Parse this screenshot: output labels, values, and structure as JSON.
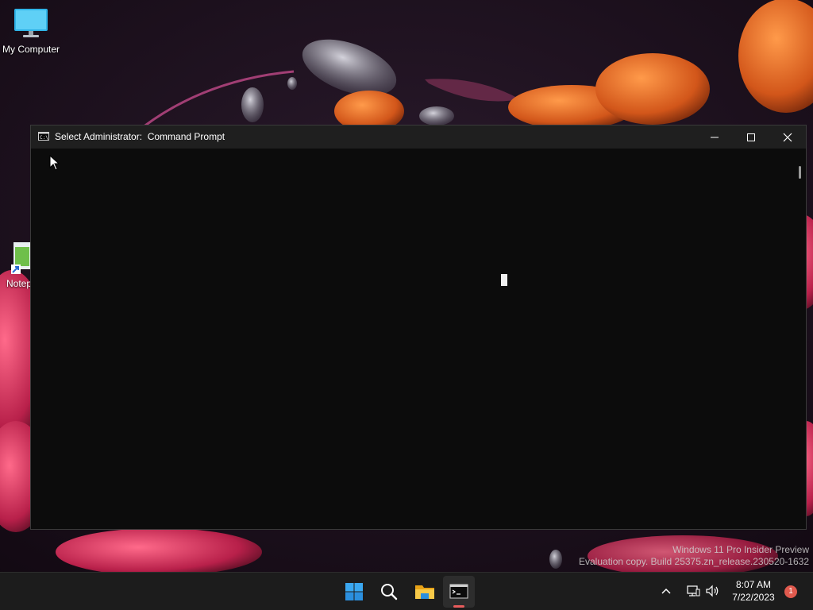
{
  "desktop": {
    "icons": [
      {
        "label": "My Computer",
        "icon": "monitor-icon"
      },
      {
        "label": "Notep",
        "icon": "notepad-shortcut-icon"
      }
    ]
  },
  "window": {
    "title": "Select Administrator:  Command Prompt",
    "icon": "console-icon",
    "controls": {
      "minimize": "minimize-icon",
      "maximize": "maximize-icon",
      "close": "close-icon"
    }
  },
  "watermark": {
    "line1": "Windows 11 Pro Insider Preview",
    "line2": "Evaluation copy. Build 25375.zn_release.230520-1632"
  },
  "taskbar": {
    "apps": [
      {
        "name": "Start",
        "icon": "windows-logo-icon"
      },
      {
        "name": "Search",
        "icon": "search-icon"
      },
      {
        "name": "File Explorer",
        "icon": "folder-icon"
      },
      {
        "name": "Command Prompt",
        "icon": "terminal-icon",
        "active": true
      }
    ],
    "tray": {
      "chevron": "chevron-up-icon",
      "network": "network-icon",
      "volume": "volume-icon",
      "time": "8:07 AM",
      "date": "7/22/2023",
      "notification_count": "1"
    }
  },
  "colors": {
    "accent_blue": "#3aa7f0",
    "notification_red": "#e05a4e",
    "console_bg": "#0c0c0c",
    "titlebar_bg": "#1f1f1f"
  }
}
